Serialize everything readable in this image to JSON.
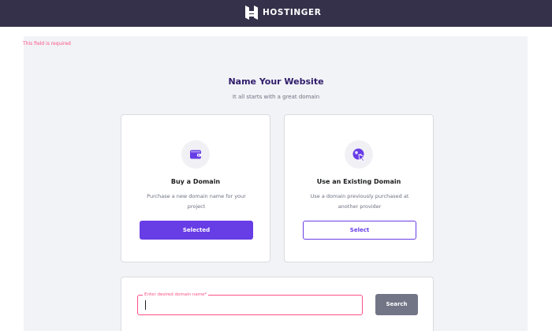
{
  "header": {
    "brand": "HOSTINGER",
    "background": "#35314a"
  },
  "main": {
    "title": "Name Your Website",
    "subtitle": "It all starts with a great domain"
  },
  "cards": {
    "buy": {
      "icon": "wallet-icon",
      "title": "Buy a Domain",
      "description": "Purchase a new domain name for your project",
      "button_label": "Selected",
      "state": "selected"
    },
    "existing": {
      "icon": "globe-cursor-icon",
      "title": "Use an Existing Domain",
      "description": "Use a domain previously purchased at another provider",
      "button_label": "Select",
      "state": "unselected"
    }
  },
  "domain_search": {
    "label": "Enter desired domain name*",
    "value": "",
    "error": "This field is required",
    "button_label": "Search"
  },
  "colors": {
    "accent": "#673de6",
    "error": "#fc5185",
    "disabled_button": "#727586"
  }
}
